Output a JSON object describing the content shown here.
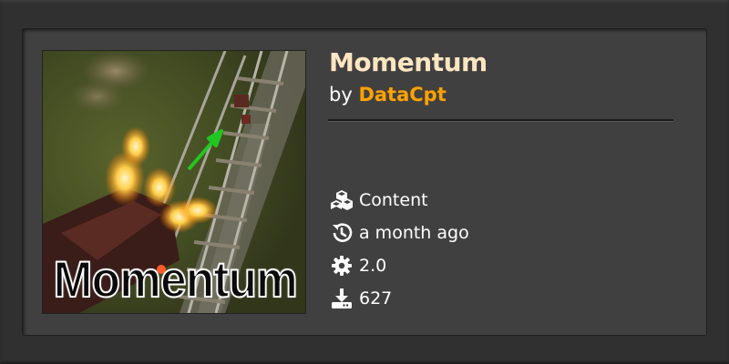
{
  "mod": {
    "title": "Momentum",
    "by_prefix": "by ",
    "author": "DataCpt",
    "thumbnail_text": "Momentum"
  },
  "details": [
    {
      "icon": "cubes-icon",
      "text": "Content"
    },
    {
      "icon": "history-icon",
      "text": "a month ago"
    },
    {
      "icon": "gear-icon",
      "text": "2.0"
    },
    {
      "icon": "download-icon",
      "text": "627"
    }
  ],
  "colors": {
    "title": "#ffe6c0",
    "author": "#ffa200",
    "panel": "#414041"
  }
}
